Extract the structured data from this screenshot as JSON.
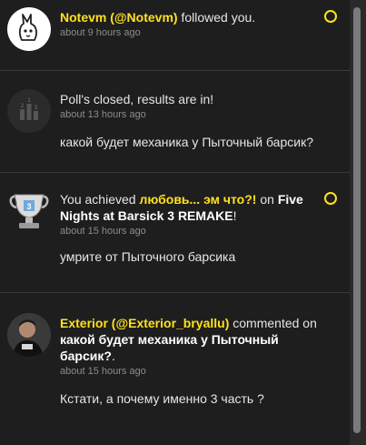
{
  "notifications": [
    {
      "user": "Notevm (@Notevm)",
      "action": " followed you.",
      "time": "about 9 hours ago",
      "avatar_icon": "bunny-avatar",
      "unread": true
    },
    {
      "headline": "Poll's closed, results are in!",
      "time": "about 13 hours ago",
      "message": "какой будет механика у Пыточный барсик?",
      "avatar_icon": "poll-icon",
      "unread": false
    },
    {
      "prefix": "You achieved ",
      "achievement": "любовь... эм что?!",
      "mid": " on ",
      "game": "Five Nights at Barsick 3 REMAKE",
      "suffix": "!",
      "time": "about 15 hours ago",
      "message": "умрите от Пыточного барсика",
      "avatar_icon": "trophy-icon",
      "unread": true
    },
    {
      "user": "Exterior (@Exterior_bryallu)",
      "action": " commented on ",
      "target": "какой будет механика у Пыточный барсик?",
      "suffix": ".",
      "time": "about 15 hours ago",
      "message": "Кстати,  а почему именно 3 часть ?",
      "avatar_icon": "user-photo-avatar",
      "unread": false
    }
  ],
  "colors": {
    "accent": "#ffe11c",
    "background": "#1e1e1e",
    "divider": "#3a3a3a"
  }
}
